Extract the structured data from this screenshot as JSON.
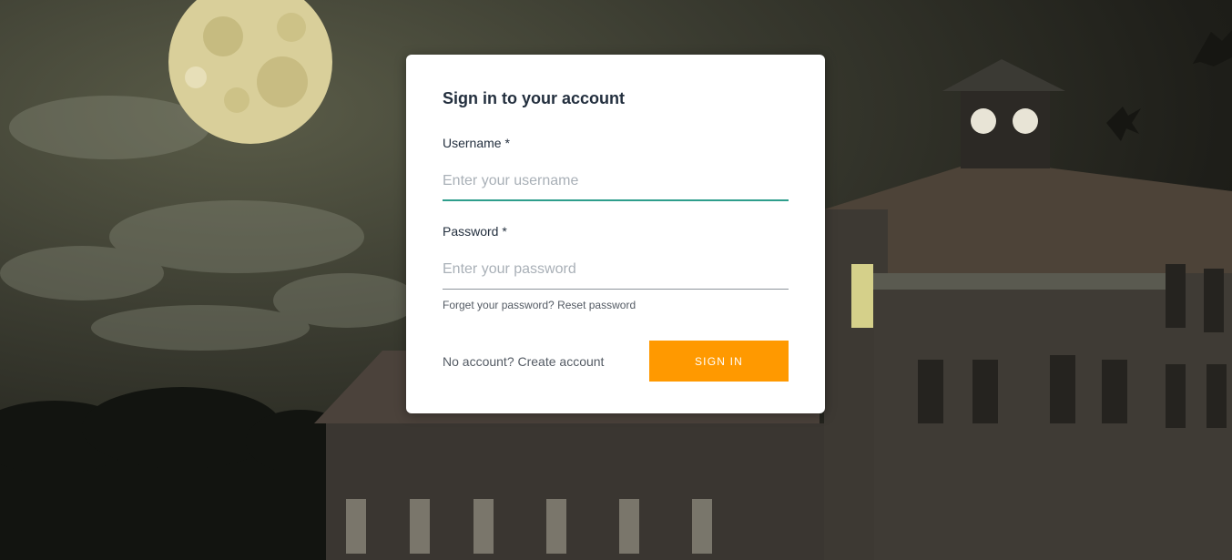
{
  "background": {
    "scene": "full-moon-haunted-house-icon"
  },
  "card": {
    "title": "Sign in to your account",
    "username": {
      "label": "Username *",
      "placeholder": "Enter your username",
      "value": ""
    },
    "password": {
      "label": "Password *",
      "placeholder": "Enter your password",
      "value": ""
    },
    "forgot": {
      "text": "Forget your password?",
      "link": "Reset password"
    },
    "no_account": {
      "text": "No account?",
      "link": "Create account"
    },
    "signin_label": "Sign In"
  },
  "colors": {
    "accent_focus": "#2e9e8c",
    "button": "#ff9900",
    "text_primary": "#232f3e",
    "text_secondary": "#545b64",
    "placeholder": "#a9b0b7"
  }
}
